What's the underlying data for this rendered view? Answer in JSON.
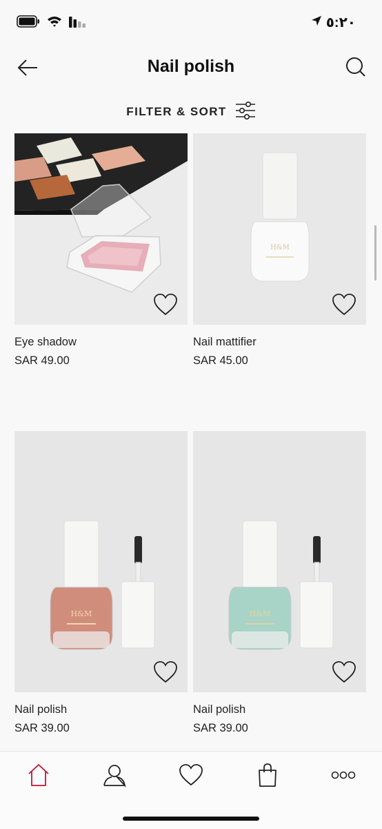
{
  "status_bar": {
    "time": "٥:٢٠",
    "icons": [
      "battery-icon",
      "wifi-icon",
      "signal-icon",
      "location-arrow-icon"
    ]
  },
  "header": {
    "title": "Nail polish",
    "back_icon": "arrow-left-icon",
    "search_icon": "search-icon"
  },
  "filter": {
    "label": "FILTER & SORT",
    "icon": "sliders-icon"
  },
  "products": [
    {
      "name": "Eye shadow",
      "price": "SAR 49.00",
      "image": "eye-shadow-palette"
    },
    {
      "name": "Nail mattifier",
      "price": "SAR 45.00",
      "image": "white-polish-bottle"
    },
    {
      "name": "Nail polish",
      "price": "SAR 39.00",
      "image": "rose-polish-bottle"
    },
    {
      "name": "Nail polish",
      "price": "SAR 39.00",
      "image": "mint-polish-bottle"
    }
  ],
  "bottom_nav": {
    "items": [
      "home-icon",
      "account-icon",
      "favourites-icon",
      "bag-icon",
      "more-icon"
    ],
    "active": "home-icon",
    "active_color": "#c8102e"
  },
  "colors": {
    "background": "#f8f8f8",
    "image_bg": "#e8e8e8",
    "accent": "#c8102e",
    "text": "#222222"
  }
}
